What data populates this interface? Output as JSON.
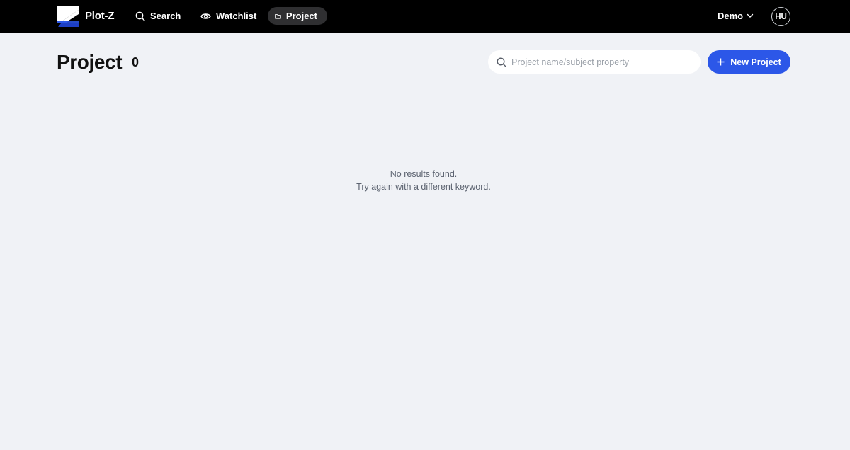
{
  "app": {
    "brand": "Plot-Z",
    "logo_icon": "plot-z-logo",
    "colors": {
      "header_bg": "#000000",
      "accent": "#2c57e8",
      "page_bg": "#f0f2f6"
    }
  },
  "nav": [
    {
      "label": "Search",
      "icon": "search-icon",
      "active": false
    },
    {
      "label": "Watchlist",
      "icon": "eye-icon",
      "active": false
    },
    {
      "label": "Project",
      "icon": "folder-icon",
      "active": true
    }
  ],
  "org": {
    "label": "Demo",
    "icon": "chevron-down-icon"
  },
  "user": {
    "initials": "HU"
  },
  "page": {
    "title": "Project",
    "count": "0"
  },
  "search": {
    "placeholder": "Project name/subject property",
    "value": ""
  },
  "actions": {
    "new_project_label": "New Project"
  },
  "empty_state": {
    "line1": "No results found.",
    "line2": "Try again with a different keyword."
  }
}
